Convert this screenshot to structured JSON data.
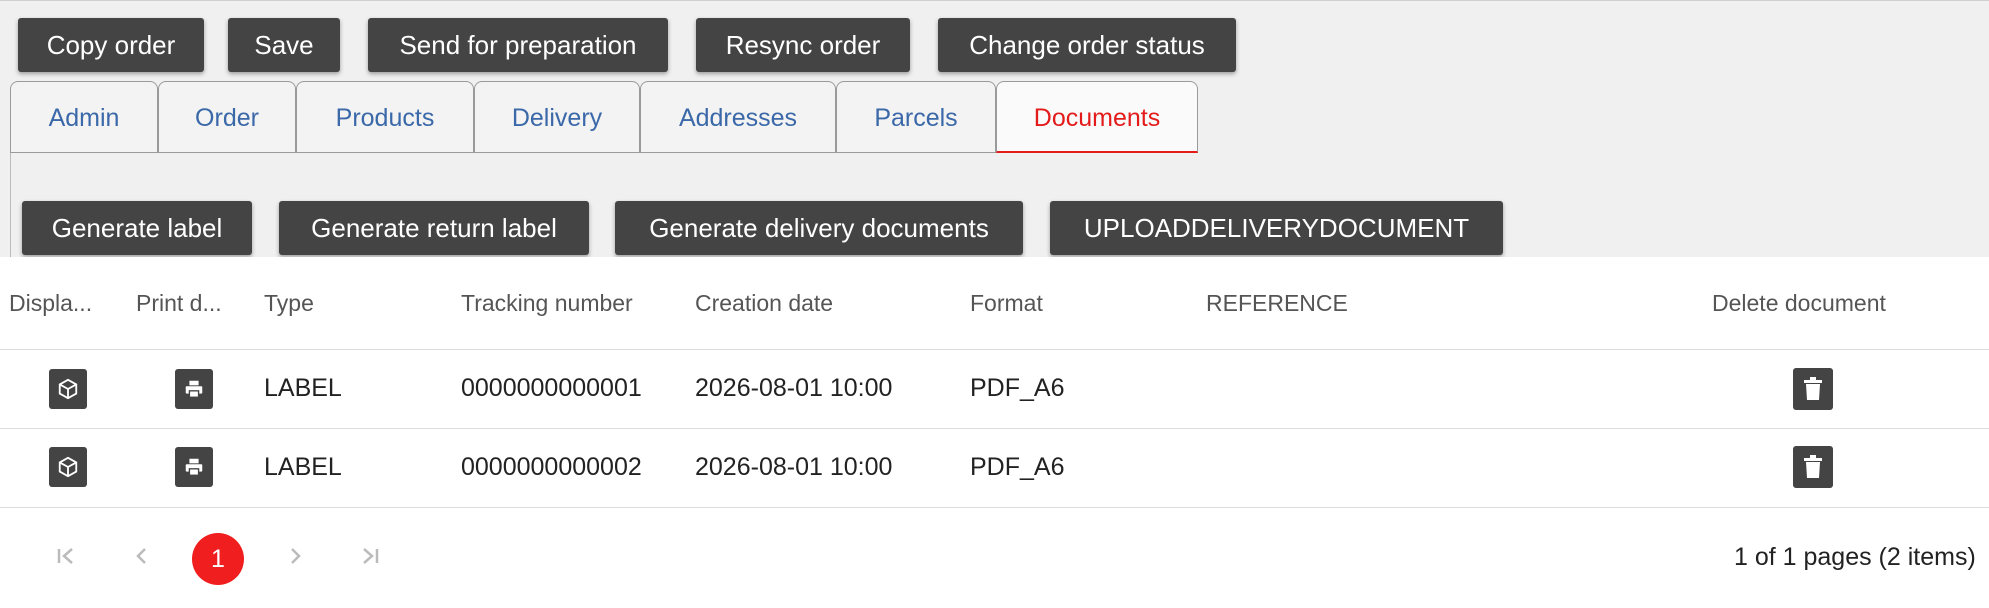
{
  "toolbar": {
    "copy_order": "Copy order",
    "save": "Save",
    "send_for_preparation": "Send for preparation",
    "resync_order": "Resync order",
    "change_order_status": "Change order status"
  },
  "tabs": [
    {
      "label": "Admin"
    },
    {
      "label": "Order"
    },
    {
      "label": "Products"
    },
    {
      "label": "Delivery"
    },
    {
      "label": "Addresses"
    },
    {
      "label": "Parcels"
    },
    {
      "label": "Documents",
      "active": true
    }
  ],
  "documents_toolbar": {
    "generate_label": "Generate label",
    "generate_return_label": "Generate return label",
    "generate_delivery_documents": "Generate delivery documents",
    "upload_delivery_document": "UPLOADDELIVERYDOCUMENT"
  },
  "table": {
    "columns": {
      "display": "Displa...",
      "print": "Print d...",
      "type": "Type",
      "tracking": "Tracking number",
      "creation": "Creation date",
      "format": "Format",
      "reference": "REFERENCE",
      "delete": "Delete document"
    },
    "rows": [
      {
        "type": "LABEL",
        "tracking": "0000000000001",
        "creation": "2026-08-01 10:00",
        "format": "PDF_A6",
        "reference": ""
      },
      {
        "type": "LABEL",
        "tracking": "0000000000002",
        "creation": "2026-08-01 10:00",
        "format": "PDF_A6",
        "reference": ""
      }
    ]
  },
  "pager": {
    "current_page": "1",
    "info": "1 of 1 pages (2 items)",
    "first_icon": "first-page-icon",
    "prev_icon": "chevron-left-icon",
    "next_icon": "chevron-right-icon",
    "last_icon": "last-page-icon"
  },
  "colors": {
    "button_bg": "#444444",
    "tab_text": "#3a68a8",
    "active_tab": "#e31b1b",
    "page_badge": "#f01e1e"
  }
}
